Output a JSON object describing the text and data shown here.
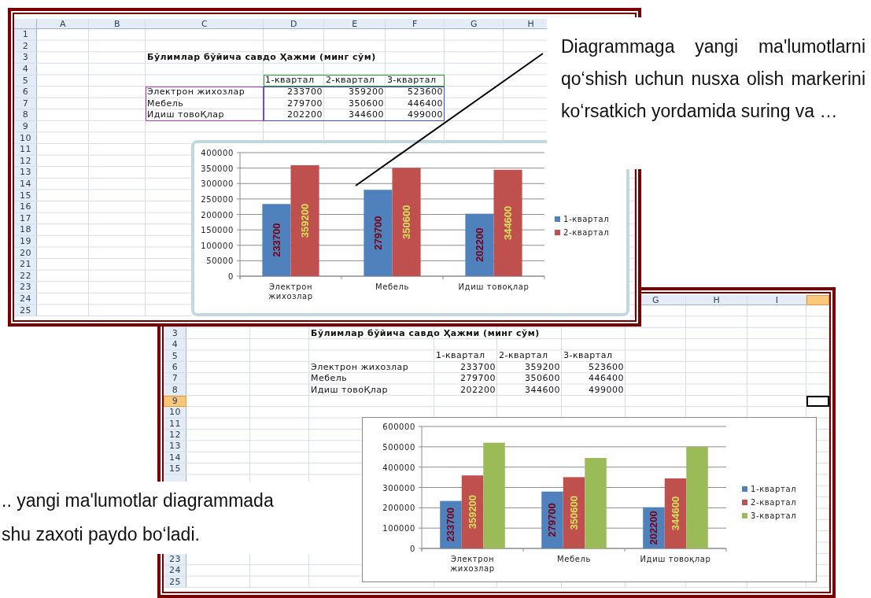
{
  "top_sheet": {
    "column_headers": [
      {
        "label": "A",
        "selected": false
      },
      {
        "label": "B",
        "selected": false
      },
      {
        "label": "C",
        "selected": false
      },
      {
        "label": "D",
        "selected": false
      },
      {
        "label": "E",
        "selected": false
      },
      {
        "label": "F",
        "selected": false
      },
      {
        "label": "G",
        "selected": false
      },
      {
        "label": "H",
        "selected": false
      }
    ],
    "rows": [
      {
        "label": "1",
        "selected": false
      },
      {
        "label": "2",
        "selected": false
      },
      {
        "label": "3",
        "selected": false
      },
      {
        "label": "4",
        "selected": false
      },
      {
        "label": "5",
        "selected": false
      },
      {
        "label": "6",
        "selected": false
      },
      {
        "label": "7",
        "selected": false
      },
      {
        "label": "8",
        "selected": false
      },
      {
        "label": "9",
        "selected": false
      },
      {
        "label": "10",
        "selected": false
      },
      {
        "label": "11",
        "selected": false
      },
      {
        "label": "12",
        "selected": false
      },
      {
        "label": "13",
        "selected": false
      },
      {
        "label": "14",
        "selected": false
      },
      {
        "label": "15",
        "selected": false
      },
      {
        "label": "16",
        "selected": false
      },
      {
        "label": "17",
        "selected": false
      },
      {
        "label": "18",
        "selected": false
      },
      {
        "label": "19",
        "selected": false
      },
      {
        "label": "20",
        "selected": false
      },
      {
        "label": "21",
        "selected": false
      },
      {
        "label": "22",
        "selected": false
      },
      {
        "label": "23",
        "selected": false
      },
      {
        "label": "24",
        "selected": false
      },
      {
        "label": "25",
        "selected": false
      }
    ],
    "table": {
      "title": "Бўлимлар бўйича савдо Ҳажми (минг сўм)",
      "columns": [
        "1-квартал",
        "2-квартал",
        "3-квартал"
      ],
      "rows": [
        {
          "name": "Электрон жихозлар",
          "values": [
            "233700",
            "359200",
            "523600"
          ]
        },
        {
          "name": "Мебель",
          "values": [
            "279700",
            "350600",
            "446400"
          ]
        },
        {
          "name": "Идиш товоҚлар",
          "values": [
            "202200",
            "344600",
            "499000"
          ]
        }
      ]
    },
    "data_range_highlighted": true,
    "chart": {
      "selected": true,
      "chart_data": {
        "type": "bar",
        "categories": [
          "Электрон жихозлар",
          "Мебель",
          "Идиш товоқлар"
        ],
        "series": [
          {
            "name": "1-квартал",
            "color": "#4f81bd",
            "values": [
              233700,
              279700,
              202200
            ]
          },
          {
            "name": "2-квартал",
            "color": "#c0504d",
            "values": [
              359200,
              350600,
              344600
            ]
          }
        ],
        "ylim": [
          0,
          400000
        ],
        "yticks": [
          0,
          50000,
          100000,
          150000,
          200000,
          250000,
          300000,
          350000,
          400000
        ],
        "grid": true,
        "legend": true,
        "value_labels": [
          [
            "233700",
            "279700",
            "202200"
          ],
          [
            "359200",
            "350600",
            "344600"
          ]
        ]
      }
    }
  },
  "instruction_callout": {
    "text": "Diagrammaga yangi ma'lumotlarni qo‘shish uchun nusxa olish markerini ko‘rsatkich yordamida suring va …"
  },
  "bottom_sheet": {
    "column_headers": [
      {
        "label": "G",
        "selected": false
      },
      {
        "label": "H",
        "selected": false
      },
      {
        "label": "I",
        "selected": false
      },
      {
        "selected": true
      }
    ],
    "rows_upper": [
      {
        "label": "3",
        "selected": false
      },
      {
        "label": "4",
        "selected": false
      },
      {
        "label": "5",
        "selected": false
      },
      {
        "label": "6",
        "selected": false
      },
      {
        "label": "7",
        "selected": false
      },
      {
        "label": "8",
        "selected": false
      },
      {
        "label": "9",
        "selected": true
      },
      {
        "label": "10",
        "selected": false
      },
      {
        "label": "11",
        "selected": false
      },
      {
        "label": "12",
        "selected": false
      },
      {
        "label": "13",
        "selected": false
      },
      {
        "label": "14",
        "selected": false
      },
      {
        "label": "15",
        "selected": false
      }
    ],
    "rows_lower": [
      {
        "label": "23",
        "selected": false
      },
      {
        "label": "24",
        "selected": false
      },
      {
        "label": "25",
        "selected": false
      }
    ],
    "table": {
      "title": "Бўлимлар бўйича савдо Ҳажми (минг сўм)",
      "columns": [
        "1-квартал",
        "2-квартал",
        "3-квартал"
      ],
      "rows": [
        {
          "name": "Электрон жихозлар",
          "values": [
            "233700",
            "359200",
            "523600"
          ]
        },
        {
          "name": "Мебель",
          "values": [
            "279700",
            "350600",
            "446400"
          ]
        },
        {
          "name": "Идиш товоҚлар",
          "values": [
            "202200",
            "344600",
            "499000"
          ]
        }
      ]
    },
    "chart": {
      "selected": false,
      "chart_data": {
        "type": "bar",
        "categories": [
          "Электрон жихозлар",
          "Мебель",
          "Идиш товоқлар"
        ],
        "series": [
          {
            "name": "1-квартал",
            "color": "#4f81bd",
            "values": [
              233700,
              279700,
              202200
            ]
          },
          {
            "name": "2-квартал",
            "color": "#c0504d",
            "values": [
              359200,
              350600,
              344600
            ]
          },
          {
            "name": "3-квартал",
            "color": "#9bbb59",
            "values": [
              520000,
              445000,
              500000
            ]
          }
        ],
        "ylim": [
          0,
          600000
        ],
        "yticks": [
          0,
          100000,
          200000,
          300000,
          400000,
          500000,
          600000
        ],
        "grid": true,
        "legend": true,
        "value_labels": [
          [
            "233700",
            "279700",
            "202200"
          ],
          [
            "359200",
            "350600",
            "344600"
          ]
        ]
      }
    }
  },
  "result_callout": {
    "text": ".. yangi ma'lumotlar diagrammada shu zaxoti paydo bo‘ladi."
  }
}
